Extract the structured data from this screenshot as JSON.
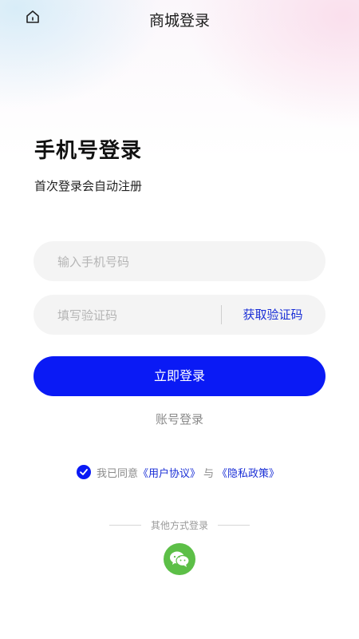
{
  "header": {
    "title": "商城登录",
    "home_icon": "home-icon"
  },
  "main": {
    "title": "手机号登录",
    "subtitle": "首次登录会自动注册",
    "phone_input": {
      "value": "",
      "placeholder": "输入手机号码"
    },
    "code_input": {
      "value": "",
      "placeholder": "填写验证码"
    },
    "get_code_label": "获取验证码",
    "login_button": "立即登录",
    "account_login": "账号登录"
  },
  "agreement": {
    "checked": true,
    "prefix": "我已同意",
    "user_agreement": "《用户协议》",
    "connector": "与",
    "privacy_policy": "《隐私政策》"
  },
  "other_login": {
    "label": "其他方式登录",
    "methods": [
      {
        "icon": "wechat-icon"
      }
    ]
  },
  "colors": {
    "accent": "#0a1af5",
    "link": "#1a2fd6",
    "wechat": "#5cbf47",
    "field_bg": "#f4f4f4"
  }
}
